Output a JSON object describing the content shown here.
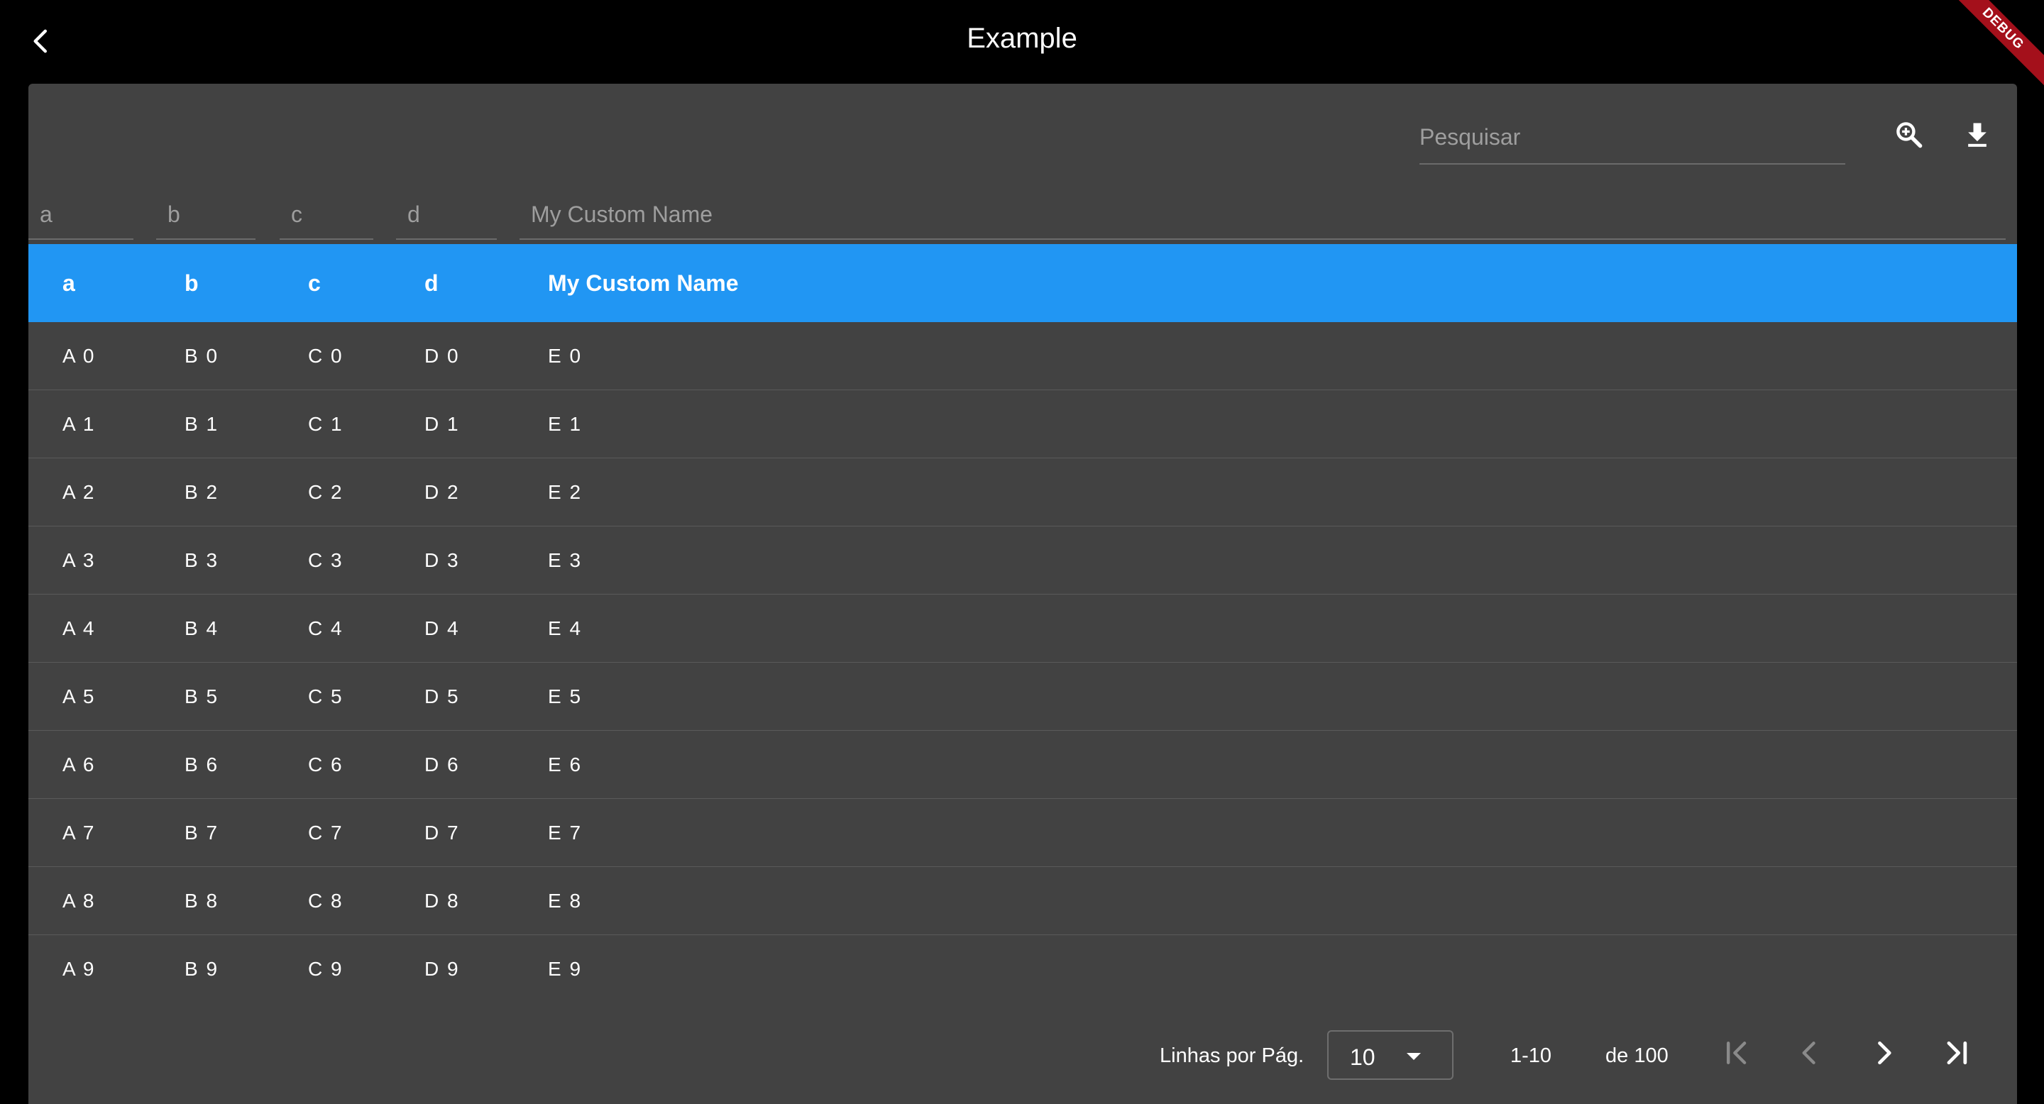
{
  "appbar": {
    "title": "Example",
    "debug_banner": "DEBUG"
  },
  "search": {
    "placeholder": "Pesquisar"
  },
  "filters": [
    {
      "placeholder": "a"
    },
    {
      "placeholder": "b"
    },
    {
      "placeholder": "c"
    },
    {
      "placeholder": "d"
    },
    {
      "placeholder": "My Custom Name"
    }
  ],
  "columns": [
    "a",
    "b",
    "c",
    "d",
    "My Custom Name"
  ],
  "rows": [
    [
      "A 0",
      "B 0",
      "C 0",
      "D 0",
      "E 0"
    ],
    [
      "A 1",
      "B 1",
      "C 1",
      "D 1",
      "E 1"
    ],
    [
      "A 2",
      "B 2",
      "C 2",
      "D 2",
      "E 2"
    ],
    [
      "A 3",
      "B 3",
      "C 3",
      "D 3",
      "E 3"
    ],
    [
      "A 4",
      "B 4",
      "C 4",
      "D 4",
      "E 4"
    ],
    [
      "A 5",
      "B 5",
      "C 5",
      "D 5",
      "E 5"
    ],
    [
      "A 6",
      "B 6",
      "C 6",
      "D 6",
      "E 6"
    ],
    [
      "A 7",
      "B 7",
      "C 7",
      "D 7",
      "E 7"
    ],
    [
      "A 8",
      "B 8",
      "C 8",
      "D 8",
      "E 8"
    ],
    [
      "A 9",
      "B 9",
      "C 9",
      "D 9",
      "E 9"
    ]
  ],
  "pagination": {
    "rows_per_page_label": "Linhas por Pág.",
    "rows_per_page_value": "10",
    "range": "1-10",
    "total": "de 100"
  },
  "colors": {
    "header_bg": "#2196f3",
    "card_bg": "#424242",
    "appbar_bg": "#000000",
    "debug_ribbon": "#a4101b"
  },
  "icons": {
    "back": "chevron-left-icon",
    "search": "zoom-in-icon",
    "download": "download-icon",
    "first_page": "first-page-icon",
    "prev_page": "chevron-left-icon",
    "next_page": "chevron-right-icon",
    "last_page": "last-page-icon"
  }
}
